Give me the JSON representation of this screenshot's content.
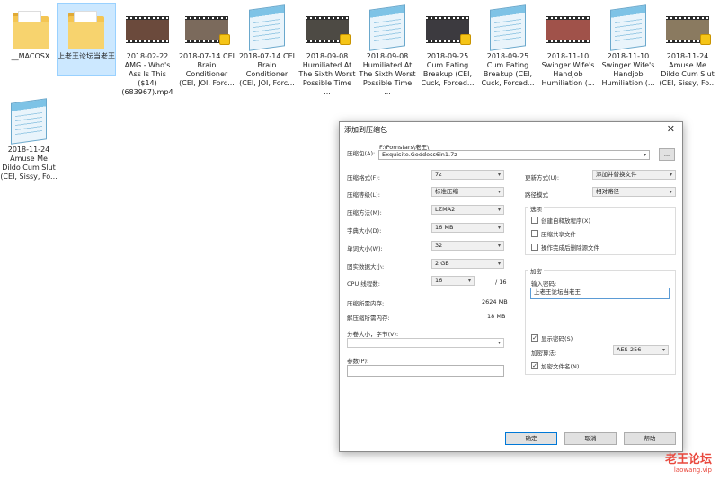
{
  "desktop": {
    "files": [
      {
        "label": "__MACOSX",
        "kind": "folder"
      },
      {
        "label": "上老王论坛当老王",
        "kind": "folder",
        "selected": true
      },
      {
        "label": "2018-02-22 AMG - Who's Ass Is This ($14) (683967).mp4",
        "kind": "video",
        "thumb_color": "#6b4a3c"
      },
      {
        "label": "2018-07-14 CEI Brain Conditioner (CEI, JOI, Forc...",
        "kind": "video",
        "thumb_color": "#7b6a5c"
      },
      {
        "label": "2018-07-14 CEI Brain Conditioner (CEI, JOI, Forc...",
        "kind": "text"
      },
      {
        "label": "2018-09-08 Humiliated At The Sixth Worst Possible Time ...",
        "kind": "video",
        "thumb_color": "#4d4a44"
      },
      {
        "label": "2018-09-08 Humiliated At The Sixth Worst Possible Time ...",
        "kind": "text"
      },
      {
        "label": "2018-09-25 Cum Eating Breakup (CEI, Cuck, Forced...",
        "kind": "video",
        "thumb_color": "#3c3a3f"
      },
      {
        "label": "2018-09-25 Cum Eating Breakup (CEI, Cuck, Forced...",
        "kind": "text"
      },
      {
        "label": "2018-11-10 Swinger Wife's Handjob Humiliation (...",
        "kind": "video",
        "thumb_color": "#a0524a"
      },
      {
        "label": "2018-11-10 Swinger Wife's Handjob Humiliation (...",
        "kind": "text"
      },
      {
        "label": "2018-11-24 Amuse Me Dildo Cum Slut (CEI, Sissy, Fo...",
        "kind": "video",
        "thumb_color": "#8a7a60"
      },
      {
        "label": "2018-11-24 Amuse Me Dildo Cum Slut (CEI, Sissy, Fo...",
        "kind": "text"
      }
    ]
  },
  "dialog": {
    "title": "添加到压缩包",
    "close_glyph": "✕",
    "archive_label": "压缩包(A):",
    "archive_path": "F:\\Pornstars\\老王\\",
    "archive_name": "Exquisite.Goddess6in1.7z",
    "browse_label": "...",
    "left": {
      "format_label": "压缩格式(F):",
      "format_value": "7z",
      "level_label": "压缩等级(L):",
      "level_value": "标准压缩",
      "method_label": "压缩方法(M):",
      "method_value": "LZMA2",
      "dict_label": "字典大小(D):",
      "dict_value": "16 MB",
      "word_label": "单词大小(W):",
      "word_value": "32",
      "solid_label": "固实数据大小:",
      "solid_value": "2 GB",
      "cpu_label": "CPU 线程数:",
      "cpu_value": "16",
      "cpu_total": "/ 16",
      "mem_comp_label": "压缩所需内存:",
      "mem_comp_value": "2624 MB",
      "mem_decomp_label": "解压缩所需内存:",
      "mem_decomp_value": "18 MB",
      "split_label": "分卷大小，字节(V):",
      "params_label": "参数(P):"
    },
    "right": {
      "update_label": "更新方式(U):",
      "update_value": "添加并替换文件",
      "path_label": "路径模式",
      "path_value": "相对路径",
      "options_title": "选项",
      "opt_sfx": "创建自释放程序(X)",
      "opt_shared": "压缩共享文件",
      "opt_delete": "操作完成后删除源文件",
      "encrypt_title": "加密",
      "password_label": "输入密码:",
      "password_value": "上老王论坛当老王",
      "show_password": "显示密码(S)",
      "enc_method_label": "加密算法:",
      "enc_method_value": "AES-256",
      "encrypt_names": "加密文件名(N)"
    },
    "buttons": {
      "ok": "确定",
      "cancel": "取消",
      "help": "帮助"
    }
  },
  "watermark": {
    "main": "老王论坛",
    "sub": "laowang.vip"
  }
}
